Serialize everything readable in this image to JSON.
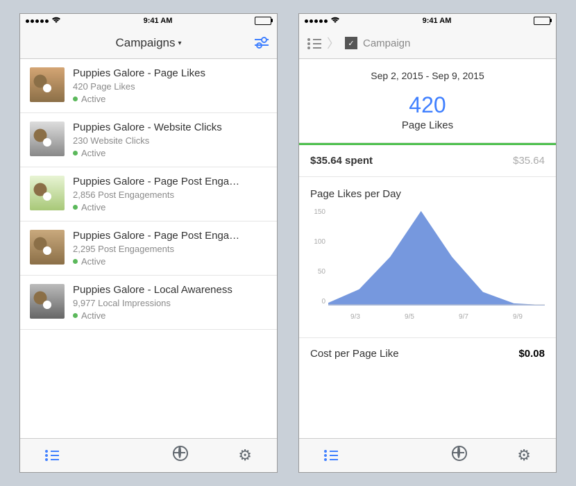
{
  "status": {
    "time": "9:41 AM"
  },
  "left": {
    "nav_title": "Campaigns",
    "rows": [
      {
        "title": "Puppies Galore - Page Likes",
        "metric": "420 Page Likes",
        "status": "Active"
      },
      {
        "title": "Puppies Galore - Website Clicks",
        "metric": "230 Website Clicks",
        "status": "Active"
      },
      {
        "title": "Puppies Galore - Page Post Enga…",
        "metric": "2,856 Post Engagements",
        "status": "Active"
      },
      {
        "title": "Puppies Galore - Page Post Enga…",
        "metric": "2,295 Post Engagements",
        "status": "Active"
      },
      {
        "title": "Puppies Galore - Local Awareness",
        "metric": "9,977 Local Impressions",
        "status": "Active"
      }
    ]
  },
  "right": {
    "breadcrumb_label": "Campaign",
    "date_range": "Sep 2, 2015 - Sep 9, 2015",
    "big_value": "420",
    "big_label": "Page Likes",
    "spent_left": "$35.64 spent",
    "spent_right": "$35.64",
    "chart_title": "Page Likes per Day",
    "cost_label": "Cost per Page Like",
    "cost_value": "$0.08"
  },
  "chart_data": {
    "type": "area",
    "title": "Page Likes per Day",
    "xlabel": "",
    "ylabel": "",
    "ylim": [
      0,
      180
    ],
    "y_ticks": [
      150,
      100,
      50,
      0
    ],
    "categories": [
      "9/3",
      "9/5",
      "9/7",
      "9/9"
    ],
    "x": [
      "9/2",
      "9/3",
      "9/4",
      "9/5",
      "9/6",
      "9/7",
      "9/8",
      "9/9"
    ],
    "values": [
      5,
      30,
      90,
      175,
      90,
      25,
      4,
      1
    ]
  }
}
